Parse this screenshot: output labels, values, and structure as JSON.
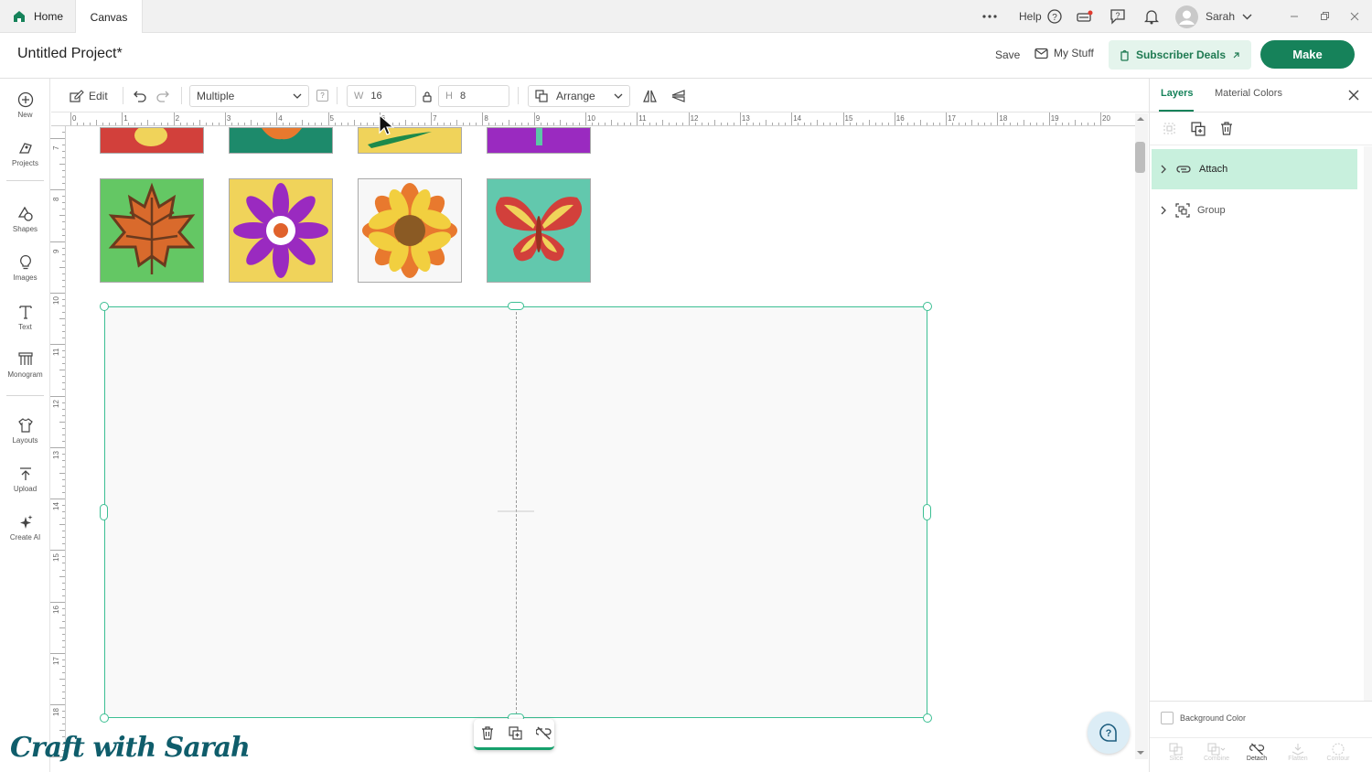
{
  "tabs": {
    "home": "Home",
    "canvas": "Canvas"
  },
  "topbar": {
    "help": "Help",
    "user": "Sarah"
  },
  "header": {
    "project_title": "Untitled Project*",
    "save": "Save",
    "my_stuff": "My Stuff",
    "subscriber_deals": "Subscriber Deals",
    "make": "Make"
  },
  "sidebar": {
    "items": [
      {
        "label": "New",
        "icon": "plus-circle-icon"
      },
      {
        "label": "Projects",
        "icon": "projects-icon"
      },
      {
        "label": "Shapes",
        "icon": "shapes-icon"
      },
      {
        "label": "Images",
        "icon": "lightbulb-icon"
      },
      {
        "label": "Text",
        "icon": "text-icon"
      },
      {
        "label": "Monogram",
        "icon": "monogram-icon"
      },
      {
        "label": "Layouts",
        "icon": "shirt-icon"
      },
      {
        "label": "Upload",
        "icon": "upload-icon"
      },
      {
        "label": "Create AI",
        "icon": "sparkle-icon"
      }
    ]
  },
  "toolbar": {
    "edit": "Edit",
    "operation": "Multiple",
    "operation_help": "?",
    "w_label": "W",
    "w_value": "16",
    "h_label": "H",
    "h_value": "8",
    "arrange": "Arrange"
  },
  "ruler": {
    "h_ticks": [
      "0",
      "1",
      "2",
      "3",
      "4",
      "5",
      "6",
      "7",
      "8",
      "9",
      "10",
      "11",
      "12",
      "13",
      "14",
      "15",
      "16",
      "17",
      "18",
      "19",
      "20"
    ],
    "v_ticks": [
      "7",
      "8",
      "9",
      "10",
      "11",
      "12",
      "13",
      "14",
      "15",
      "16",
      "17",
      "18"
    ]
  },
  "canvas": {
    "tiles_top_row": [
      {
        "name": "red-tile",
        "bg": "#d2403b"
      },
      {
        "name": "green-tile",
        "bg": "#1d8a6b"
      },
      {
        "name": "yellow-tile",
        "bg": "#f0d35a"
      },
      {
        "name": "purple-tile",
        "bg": "#9a2ac0"
      }
    ],
    "tiles": [
      {
        "name": "maple-leaf-tile",
        "bg": "#64c764"
      },
      {
        "name": "purple-flower-tile",
        "bg": "#f0d35a"
      },
      {
        "name": "sunflower-tile",
        "bg": "#f7f7f7"
      },
      {
        "name": "butterfly-tile",
        "bg": "#62c8ad"
      }
    ],
    "selection_color": "#3cbf93"
  },
  "right_panel": {
    "tabs": [
      "Layers",
      "Material Colors"
    ],
    "active_tab": "Layers",
    "layers": [
      {
        "label": "Attach",
        "selected": true
      },
      {
        "label": "Group",
        "selected": false
      }
    ],
    "background_color": "Background Color",
    "bottom_actions": [
      "Slice",
      "Combine",
      "Detach",
      "Flatten",
      "Contour"
    ]
  },
  "watermark": "Craft with Sarah",
  "colors": {
    "brand_green": "#16825a",
    "accent": "#3cbf93"
  }
}
